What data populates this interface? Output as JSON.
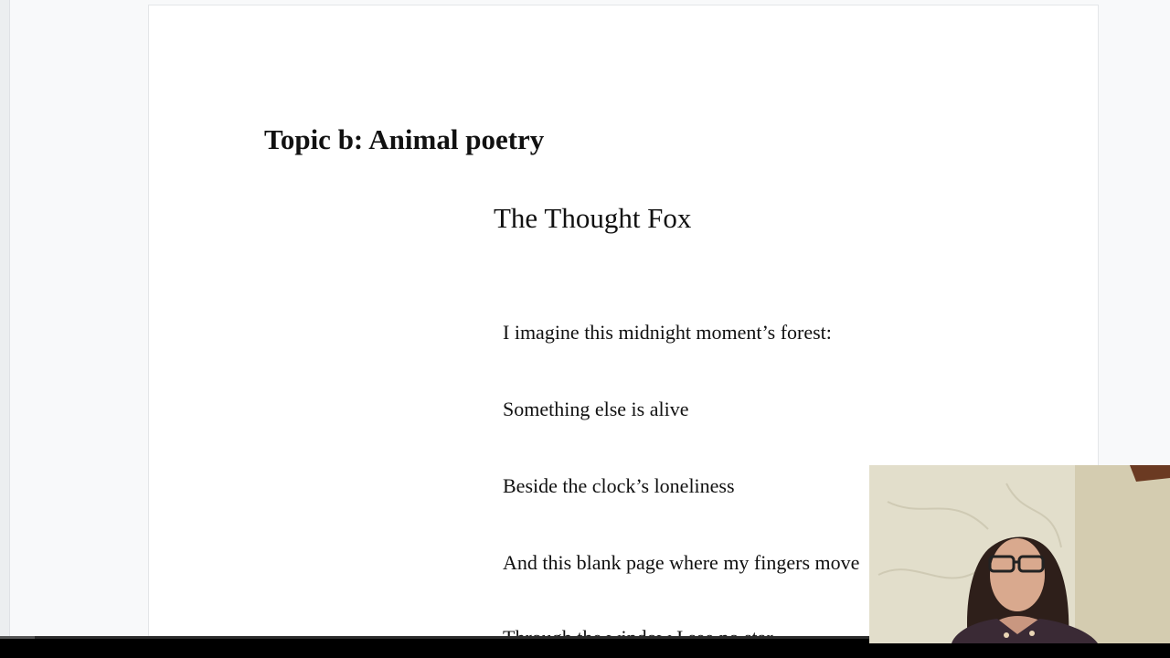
{
  "document": {
    "heading": "Topic b: Animal poetry",
    "poem_title": "The Thought Fox",
    "lines": [
      "I imagine this midnight moment’s forest:",
      "Something else is alive",
      "Beside the clock’s loneliness",
      "And this blank page where my fingers move",
      "Through the window I see no star"
    ]
  },
  "player": {
    "progress": 0.03
  },
  "colors": {
    "page": "#ffffff",
    "background": "#f8f9fa",
    "bar": "#000000"
  }
}
